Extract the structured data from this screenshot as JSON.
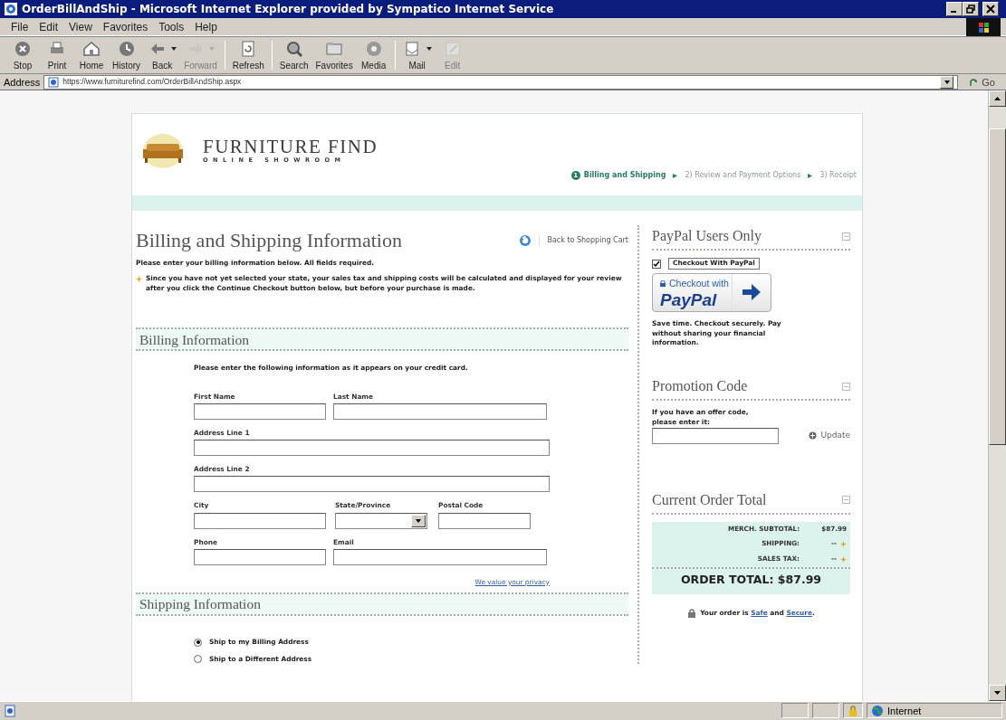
{
  "window": {
    "title": "OrderBillAndShip - Microsoft Internet Explorer provided by Sympatico Internet Service"
  },
  "menu": [
    "File",
    "Edit",
    "View",
    "Favorites",
    "Tools",
    "Help"
  ],
  "toolbar": [
    {
      "kind": "stop",
      "label": "Stop",
      "disabled": false,
      "dropdown": false
    },
    {
      "kind": "print",
      "label": "Print",
      "disabled": false,
      "dropdown": false
    },
    {
      "kind": "home",
      "label": "Home",
      "disabled": false,
      "dropdown": false
    },
    {
      "kind": "history",
      "label": "History",
      "disabled": false,
      "dropdown": false
    },
    {
      "kind": "back",
      "label": "Back",
      "disabled": false,
      "dropdown": true
    },
    {
      "kind": "forward",
      "label": "Forward",
      "disabled": true,
      "dropdown": true
    },
    {
      "kind": "refresh",
      "label": "Refresh",
      "disabled": false,
      "dropdown": false
    },
    {
      "kind": "search",
      "label": "Search",
      "disabled": false,
      "dropdown": false
    },
    {
      "kind": "favorites",
      "label": "Favorites",
      "disabled": false,
      "dropdown": false
    },
    {
      "kind": "media",
      "label": "Media",
      "disabled": false,
      "dropdown": false
    },
    {
      "kind": "mail",
      "label": "Mail",
      "disabled": false,
      "dropdown": true
    },
    {
      "kind": "edit",
      "label": "Edit",
      "disabled": true,
      "dropdown": false
    }
  ],
  "address": {
    "label": "Address",
    "url": "https://www.furniturefind.com/OrderBillAndShip.aspx",
    "go": "Go"
  },
  "page": {
    "logo": {
      "name": "FURNITURE FIND",
      "tagline": "ONLINE SHOWROOM"
    },
    "steps": [
      {
        "number": "1",
        "label": "Billing and Shipping",
        "selected": true
      },
      {
        "label": "2) Review and Payment Options",
        "selected": false
      },
      {
        "label": "3) Receipt",
        "selected": false
      }
    ],
    "heading": "Billing and Shipping Information",
    "back_link": "Back to Shopping Cart",
    "intro": "Please enter your billing information below. All fields required.",
    "note": "Since you have not yet selected your state, your sales tax and shipping costs will be calculated and displayed for your review after you click the Continue Checkout button below, but before your purchase is made.",
    "billing": {
      "title": "Billing Information",
      "instruction": "Please enter the following information as it appears on your credit card.",
      "rows": [
        [
          {
            "label": "First Name",
            "kind": "text"
          },
          {
            "label": "Last Name",
            "kind": "text"
          }
        ],
        [
          {
            "label": "Address Line 1",
            "kind": "text"
          }
        ],
        [
          {
            "label": "Address Line 2",
            "kind": "text"
          }
        ],
        [
          {
            "label": "City",
            "kind": "text"
          },
          {
            "label": "State/Province",
            "kind": "select"
          },
          {
            "label": "Postal Code",
            "kind": "text"
          }
        ],
        [
          {
            "label": "Phone",
            "kind": "text"
          },
          {
            "label": "Email",
            "kind": "text"
          }
        ]
      ],
      "privacy_link": "We value your privacy"
    },
    "shipping": {
      "title": "Shipping Information",
      "options": [
        {
          "label": "Ship to my Billing Address",
          "selected": true
        },
        {
          "label": "Ship to a Different Address",
          "selected": false
        }
      ]
    },
    "sidebar": {
      "paypal": {
        "title": "PayPal Users Only",
        "checkbox": {
          "label": "Checkout With PayPal",
          "checked": true
        },
        "button": {
          "line1": "Checkout with",
          "line2": "PayPal"
        },
        "text": "Save time. Checkout securely. Pay without sharing your financial information."
      },
      "promo": {
        "title": "Promotion Code",
        "text": "If you have an offer code, please enter it:",
        "button": "Update"
      },
      "totals": {
        "title": "Current Order Total",
        "rows": [
          {
            "label": "MERCH. SUBTOTAL:",
            "value": "$87.99",
            "note": false
          },
          {
            "label": "SHIPPING:",
            "value": "--",
            "note": true
          },
          {
            "label": "SALES TAX:",
            "value": "--",
            "note": true
          }
        ],
        "total": "ORDER TOTAL: $87.99"
      },
      "secure": [
        {
          "kind": "text",
          "text": "Your order is "
        },
        {
          "kind": "link",
          "text": "Safe"
        },
        {
          "kind": "text",
          "text": " and "
        },
        {
          "kind": "link",
          "text": "Secure"
        },
        {
          "kind": "text",
          "text": "."
        }
      ]
    }
  },
  "status_bar": {
    "zone": "Internet"
  }
}
